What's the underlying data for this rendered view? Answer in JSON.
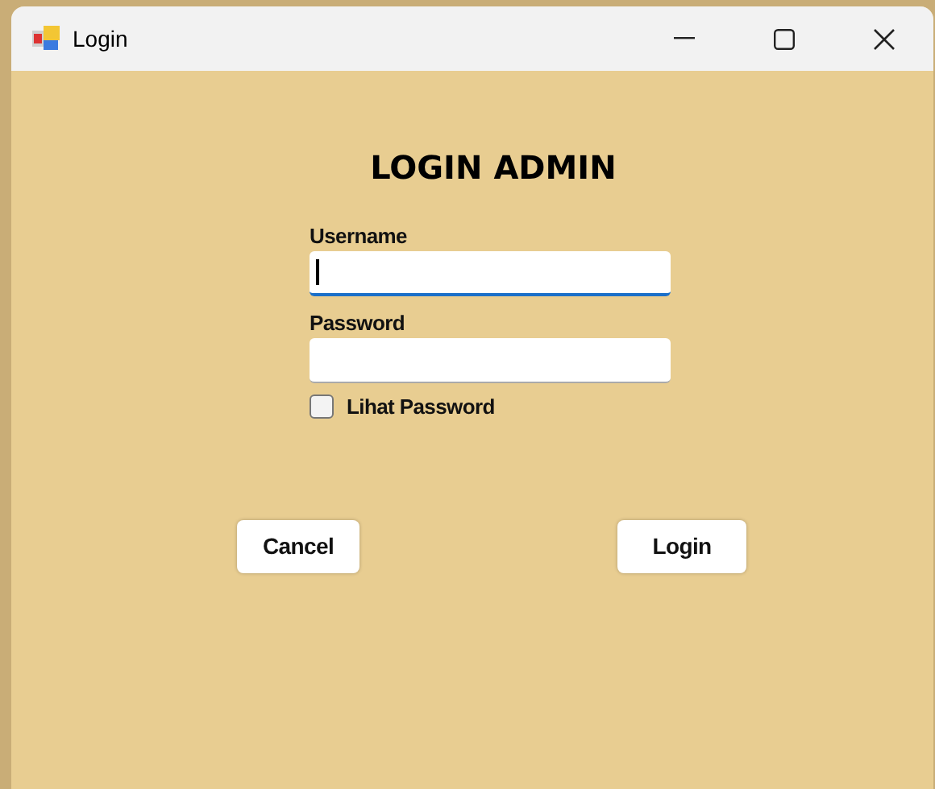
{
  "window": {
    "title": "Login"
  },
  "heading": "LOGIN ADMIN",
  "fields": [
    {
      "label": "Username",
      "focused": true
    },
    {
      "label": "Password",
      "focused": false
    }
  ],
  "show_password": {
    "label": "Lihat Password",
    "checked": false
  },
  "buttons": [
    {
      "label": "Cancel",
      "kind": "cancel"
    },
    {
      "label": "Login",
      "kind": "submit"
    }
  ]
}
